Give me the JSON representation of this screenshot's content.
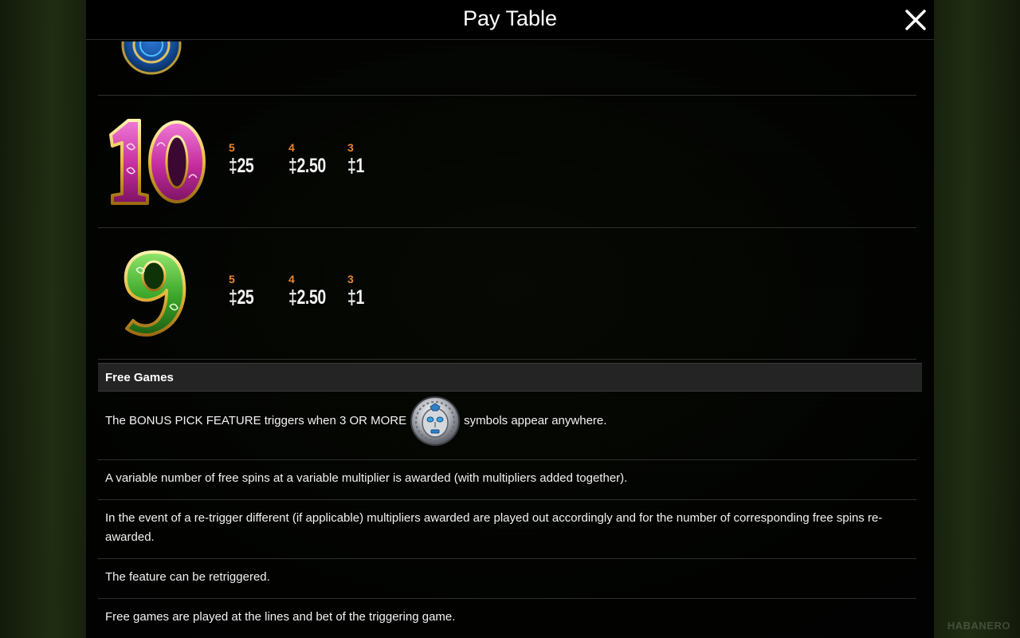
{
  "header": {
    "title": "Pay Table"
  },
  "icons": {
    "close": "close-icon",
    "top_symbol": "partial-coin-symbol-icon",
    "bonus_symbol": "silver-mask-coin-icon"
  },
  "paytable": [
    {
      "symbol": "10",
      "symbol_color": "#d63fb8",
      "pays": [
        {
          "count": "5",
          "value": "‡25"
        },
        {
          "count": "4",
          "value": "‡2.50"
        },
        {
          "count": "3",
          "value": "‡1"
        }
      ]
    },
    {
      "symbol": "9",
      "symbol_color": "#3fae32",
      "pays": [
        {
          "count": "5",
          "value": "‡25"
        },
        {
          "count": "4",
          "value": "‡2.50"
        },
        {
          "count": "3",
          "value": "‡1"
        }
      ]
    }
  ],
  "free_games": {
    "title": "Free Games",
    "trigger_before": "The BONUS PICK FEATURE triggers when 3 OR MORE",
    "trigger_after": "symbols appear anywhere.",
    "rules": [
      "A variable number of free spins at a variable multiplier is awarded (with multipliers added together).",
      "In the event of a re-trigger different (if applicable) multipliers awarded are played out accordingly and for the number of corresponding free spins re-awarded.",
      "The feature can be retriggered.",
      "Free games are played at the lines and bet of the triggering game."
    ]
  },
  "branding": {
    "text": "HABANERO"
  },
  "colors": {
    "count_accent": "#e8852c",
    "panel_bg": "#000000",
    "section_header_bg": "#242424"
  }
}
